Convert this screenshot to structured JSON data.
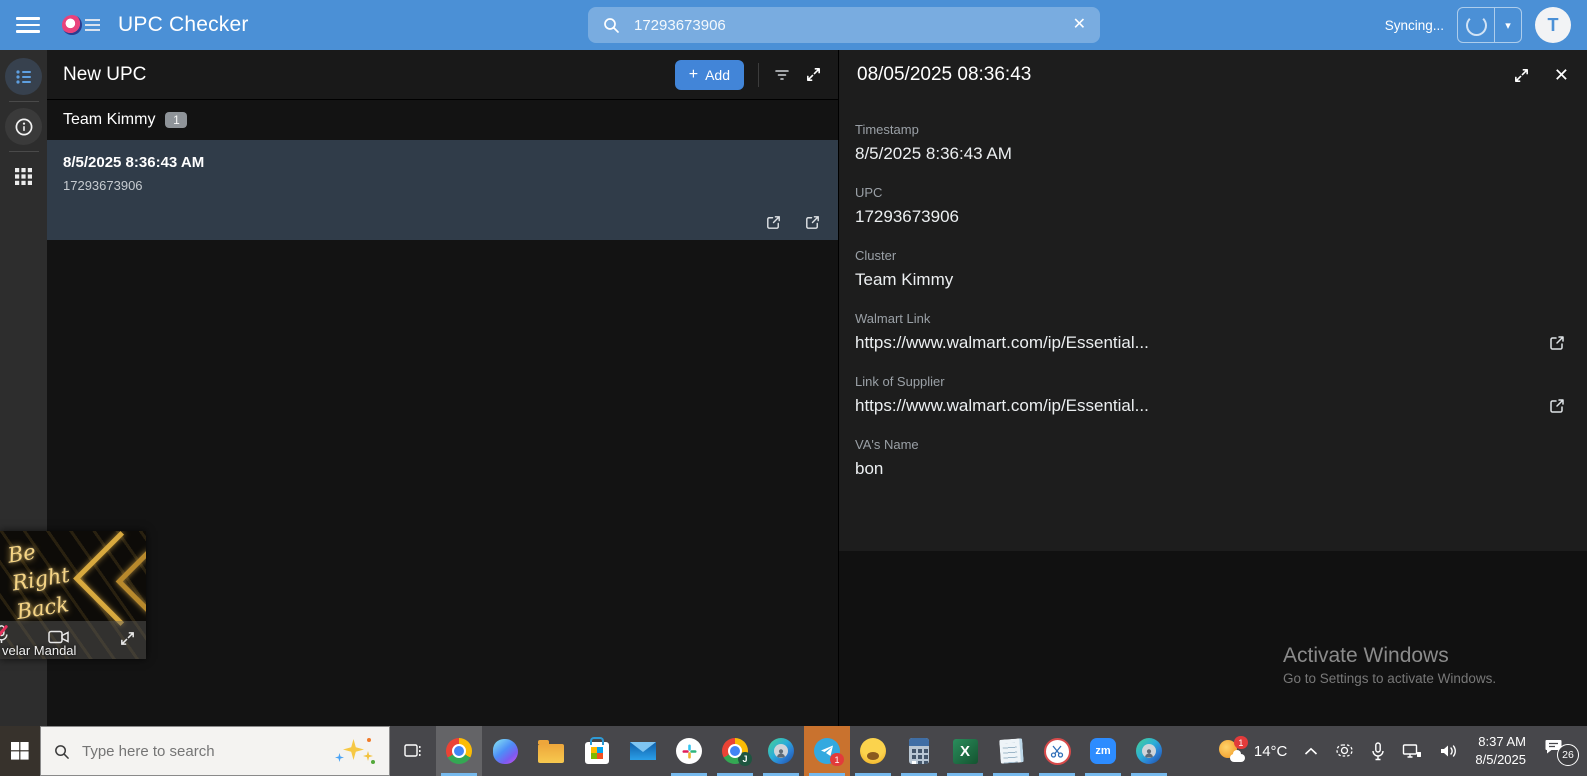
{
  "header": {
    "title": "UPC Checker",
    "search": {
      "value": "17293673906"
    },
    "sync_label": "Syncing...",
    "avatar_initial": "T"
  },
  "icons": {
    "close": "✕",
    "caret_down": "▾",
    "plus": "+"
  },
  "list_panel": {
    "title": "New UPC",
    "add_button_label": "Add",
    "group_label": "Team Kimmy",
    "group_count": "1",
    "item": {
      "title": "8/5/2025 8:36:43 AM",
      "subtitle": "17293673906"
    }
  },
  "detail_panel": {
    "title": "08/05/2025 08:36:43",
    "fields": [
      {
        "label": "Timestamp",
        "value": "8/5/2025 8:36:43 AM"
      },
      {
        "label": "UPC",
        "value": "17293673906"
      },
      {
        "label": "Cluster",
        "value": "Team Kimmy"
      },
      {
        "label": "Walmart Link",
        "value": "https://www.walmart.com/ip/Essential...",
        "external_link": true
      },
      {
        "label": "Link of Supplier",
        "value": "https://www.walmart.com/ip/Essential...",
        "external_link": true
      },
      {
        "label": "VA's Name",
        "value": "bon"
      }
    ]
  },
  "watermark": {
    "title": "Activate Windows",
    "subtitle": "Go to Settings to activate Windows."
  },
  "webcam_overlay": {
    "message": [
      "Be",
      "Right",
      "Back"
    ],
    "participant_name": "velar Mandal"
  },
  "taskbar": {
    "search_placeholder": "Type here to search",
    "chrome_profile_badge": "J",
    "telegram_badge": "1",
    "excel_label": "X",
    "zoom_label": "zm",
    "weather": {
      "temp": "14°C",
      "badge": "1"
    },
    "clock": {
      "time": "8:37 AM",
      "date": "8/5/2025"
    },
    "notification_count": "26"
  },
  "colors": {
    "header_blue": "#4b90d6",
    "accent_blue": "#4285d8",
    "selected_row": "#303c49",
    "running_underline": "#76b9ed",
    "attention_orange": "#c9722e"
  }
}
